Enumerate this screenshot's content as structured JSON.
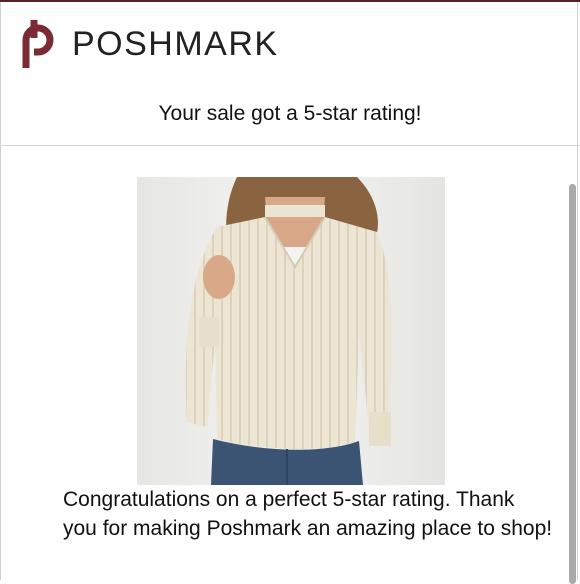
{
  "brand": {
    "name": "POSHMARK",
    "color": "#7a2a33"
  },
  "email": {
    "subject": "Your sale got a 5-star rating!",
    "message": "Congratulations on a perfect 5-star rating. Thank you for making Poshmark an amazing place to shop!"
  },
  "product": {
    "image_icon": "cream-knit-sweater-photo"
  },
  "colors": {
    "top_border": "#5a1f25",
    "scrollbar": "#a9a9a9"
  }
}
